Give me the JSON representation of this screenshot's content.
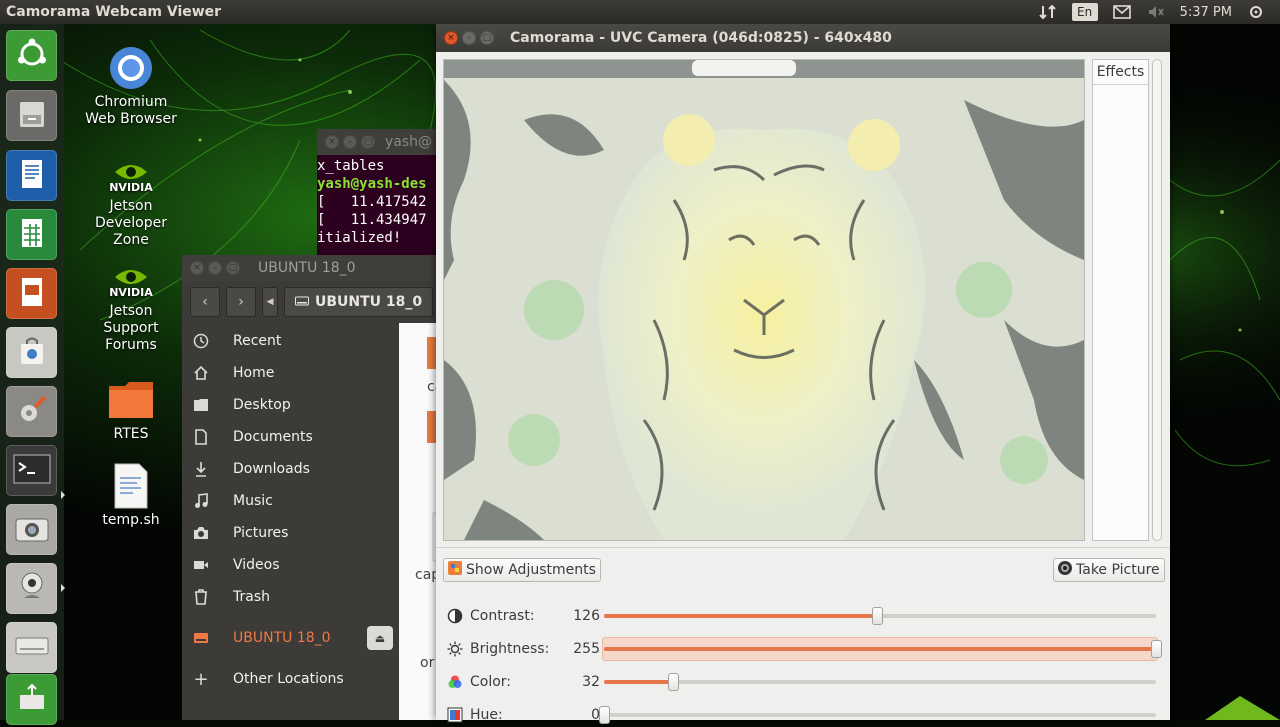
{
  "top_panel": {
    "app_title": "Camorama Webcam Viewer",
    "keyboard_layout": "En",
    "clock": "5:37 PM"
  },
  "launcher": {
    "items": [
      "ubuntu-logo-icon",
      "file-cabinet-icon",
      "writer-document-icon",
      "calc-spreadsheet-icon",
      "impress-presentation-icon",
      "software-store-bag-icon",
      "settings-tools-icon",
      "terminal-icon",
      "camera-icon",
      "webcam-icon",
      "drive-icon",
      "usb-drive-icon"
    ]
  },
  "desktop": {
    "icons": [
      {
        "label": "Chromium Web Browser"
      },
      {
        "label": "Jetson Developer Zone",
        "brand": "NVIDIA"
      },
      {
        "label": "Jetson Support Forums",
        "brand": "NVIDIA"
      },
      {
        "label": "RTES"
      },
      {
        "label": "temp.sh"
      }
    ]
  },
  "terminal": {
    "title": "yash@",
    "lines": [
      "x_tables",
      "yash@yash-des",
      "[   11.417542",
      "[   11.434947",
      "itialized!"
    ]
  },
  "files": {
    "title": "UBUNTU 18_0",
    "path_label": "UBUNTU 18_0",
    "sidebar": [
      {
        "label": "Recent"
      },
      {
        "label": "Home"
      },
      {
        "label": "Desktop"
      },
      {
        "label": "Documents"
      },
      {
        "label": "Downloads"
      },
      {
        "label": "Music"
      },
      {
        "label": "Pictures"
      },
      {
        "label": "Videos"
      },
      {
        "label": "Trash"
      },
      {
        "label": "UBUNTU 18_0"
      },
      {
        "label": "Other Locations"
      }
    ],
    "content_fragments": [
      "ca",
      "cap",
      "or"
    ]
  },
  "camorama": {
    "title": "Camorama - UVC Camera (046d:0825) - 640x480",
    "effects_header": "Effects",
    "show_adjustments": "Show Adjustments",
    "take_picture": "Take Picture",
    "adjustments": [
      {
        "label": "Contrast:",
        "value": "126",
        "level": 0.494
      },
      {
        "label": "Brightness:",
        "value": "255",
        "level": 1.0
      },
      {
        "label": "Color:",
        "value": "32",
        "level": 0.125
      },
      {
        "label": "Hue:",
        "value": "0",
        "level": 0.0
      }
    ]
  },
  "colors": {
    "accent": "#e8744a",
    "close_button": "#e0572a",
    "terminal_bg": "#2c001e",
    "sidebar_bg": "#3c3b37"
  }
}
